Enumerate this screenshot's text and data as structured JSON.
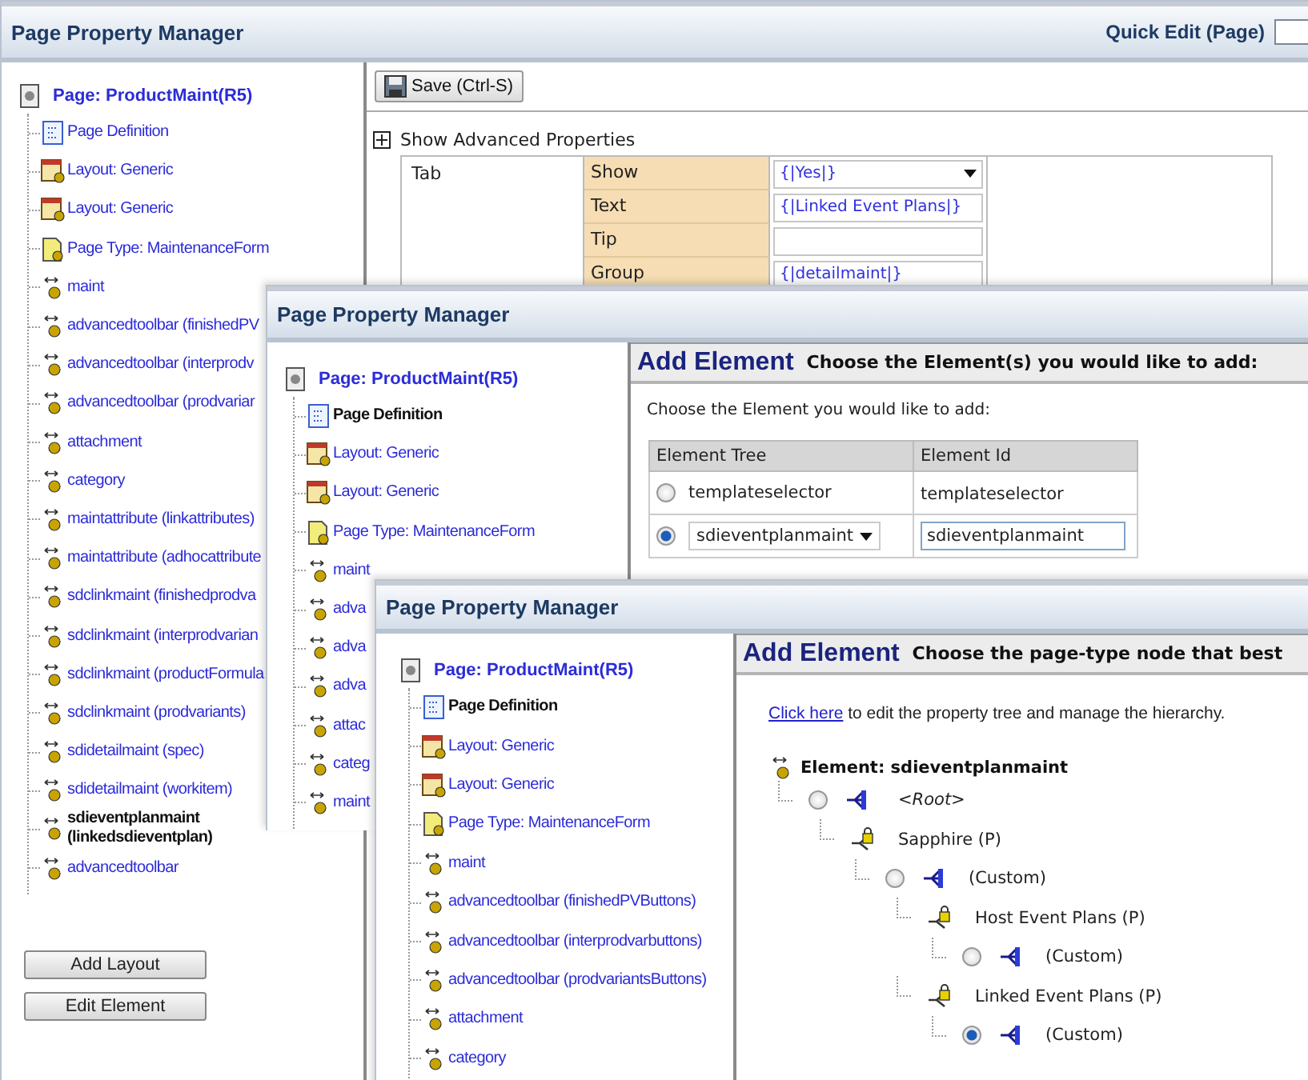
{
  "main_window": {
    "title": "Page Property Manager",
    "quick_edit": {
      "label": "Quick Edit (Page)"
    },
    "tree": {
      "root": "Page: ProductMaint(R5)",
      "items": [
        {
          "label": "Page Definition",
          "kind": "definition",
          "selected": false
        },
        {
          "label": "Layout: Generic",
          "kind": "layout",
          "selected": false
        },
        {
          "label": "Layout: Generic",
          "kind": "layout",
          "selected": false
        },
        {
          "label": "Page Type: MaintenanceForm",
          "kind": "pagetype",
          "selected": false
        },
        {
          "label": "maint",
          "kind": "element",
          "selected": false
        },
        {
          "label": "advancedtoolbar (finishedPV",
          "kind": "element",
          "selected": false
        },
        {
          "label": "advancedtoolbar (interprodv",
          "kind": "element",
          "selected": false
        },
        {
          "label": "advancedtoolbar (prodvariar",
          "kind": "element",
          "selected": false
        },
        {
          "label": "attachment",
          "kind": "element",
          "selected": false
        },
        {
          "label": "category",
          "kind": "element",
          "selected": false
        },
        {
          "label": "maintattribute (linkattributes)",
          "kind": "element",
          "selected": false
        },
        {
          "label": "maintattribute (adhocattribute",
          "kind": "element",
          "selected": false
        },
        {
          "label": "sdclinkmaint (finishedprodva",
          "kind": "element",
          "selected": false
        },
        {
          "label": "sdclinkmaint (interprodvarian",
          "kind": "element",
          "selected": false
        },
        {
          "label": "sdclinkmaint (productFormula",
          "kind": "element",
          "selected": false
        },
        {
          "label": "sdclinkmaint (prodvariants)",
          "kind": "element",
          "selected": false
        },
        {
          "label": "sdidetailmaint (spec)",
          "kind": "element",
          "selected": false
        },
        {
          "label": "sdidetailmaint (workitem)",
          "kind": "element",
          "selected": false
        },
        {
          "label": "sdieventplanmaint (linkedsdieventplan)",
          "kind": "element",
          "selected": true
        },
        {
          "label": "advancedtoolbar",
          "kind": "element",
          "selected": false
        }
      ]
    },
    "buttons": [
      "Add Layout",
      "Edit Element"
    ],
    "save_button": "Save (Ctrl-S)",
    "advanced": {
      "label": "Show Advanced Properties",
      "expanded": false
    },
    "properties": {
      "group": "Tab",
      "rows": [
        {
          "label": "Show",
          "kind": "select",
          "value": "{|Yes|}"
        },
        {
          "label": "Text",
          "kind": "input",
          "value": "{|Linked Event Plans|}"
        },
        {
          "label": "Tip",
          "kind": "input"
        },
        {
          "label": "Group",
          "kind": "input",
          "value": "{|detailmaint|}"
        }
      ]
    }
  },
  "second_window": {
    "title": "Page Property Manager",
    "tree": {
      "root": "Page: ProductMaint(R5)",
      "items": [
        {
          "label": "Page Definition",
          "kind": "definition",
          "selected": true
        },
        {
          "label": "Layout: Generic",
          "kind": "layout",
          "selected": false
        },
        {
          "label": "Layout: Generic",
          "kind": "layout",
          "selected": false
        },
        {
          "label": "Page Type: MaintenanceForm",
          "kind": "pagetype",
          "selected": false
        },
        {
          "label": "maint",
          "kind": "element",
          "selected": false
        },
        {
          "label": "adva",
          "kind": "element",
          "selected": false
        },
        {
          "label": "adva",
          "kind": "element",
          "selected": false
        },
        {
          "label": "adva",
          "kind": "element",
          "selected": false
        },
        {
          "label": "attac",
          "kind": "element",
          "selected": false
        },
        {
          "label": "categ",
          "kind": "element",
          "selected": false
        },
        {
          "label": "maint",
          "kind": "element",
          "selected": false
        }
      ]
    },
    "heading": "Add Element",
    "subheading": "Choose the Element(s) you would like to add:",
    "prompt": "Choose the Element you would like to add:",
    "table": {
      "columns": [
        "Element Tree",
        "Element Id"
      ],
      "rows": [
        {
          "selected": false,
          "cells": [
            {
              "kind": "text",
              "text": "templateselector"
            },
            {
              "kind": "text",
              "text": "templateselector"
            }
          ]
        },
        {
          "selected": true,
          "cells": [
            {
              "kind": "select",
              "text": "sdieventplanmaint"
            },
            {
              "kind": "input",
              "text": "sdieventplanmaint"
            }
          ]
        }
      ]
    }
  },
  "third_window": {
    "title": "Page Property Manager",
    "tree": {
      "root": "Page: ProductMaint(R5)",
      "items": [
        {
          "label": "Page Definition",
          "kind": "definition",
          "selected": true
        },
        {
          "label": "Layout: Generic",
          "kind": "layout",
          "selected": false
        },
        {
          "label": "Layout: Generic",
          "kind": "layout",
          "selected": false
        },
        {
          "label": "Page Type: MaintenanceForm",
          "kind": "pagetype",
          "selected": false
        },
        {
          "label": "maint",
          "kind": "element",
          "selected": false
        },
        {
          "label": "advancedtoolbar (finishedPVButtons)",
          "kind": "element",
          "selected": false
        },
        {
          "label": "advancedtoolbar (interprodvarbuttons)",
          "kind": "element",
          "selected": false
        },
        {
          "label": "advancedtoolbar (prodvariantsButtons)",
          "kind": "element",
          "selected": false
        },
        {
          "label": "attachment",
          "kind": "element",
          "selected": false
        },
        {
          "label": "category",
          "kind": "element",
          "selected": false
        }
      ]
    },
    "heading": "Add Element",
    "subheading": "Choose the page-type node that best",
    "hint": {
      "link": "Click here",
      "text": " to edit the property tree and manage the hierarchy."
    },
    "element_tree": {
      "label": "Element: sdieventplanmaint",
      "children": [
        {
          "kind": "root",
          "label": "<Root>",
          "selected": false,
          "children": [
            {
              "kind": "locked",
              "label": "Sapphire (P)",
              "children": [
                {
                  "kind": "radio",
                  "label": "(Custom)",
                  "selected": false,
                  "children": [
                    {
                      "kind": "locked",
                      "label": "Host Event Plans (P)",
                      "children": [
                        {
                          "kind": "radio",
                          "label": "(Custom)",
                          "selected": false
                        }
                      ]
                    },
                    {
                      "kind": "locked",
                      "label": "Linked Event Plans (P)",
                      "children": [
                        {
                          "kind": "radio",
                          "label": "(Custom)",
                          "selected": true
                        }
                      ]
                    }
                  ]
                }
              ]
            }
          ]
        }
      ]
    }
  }
}
